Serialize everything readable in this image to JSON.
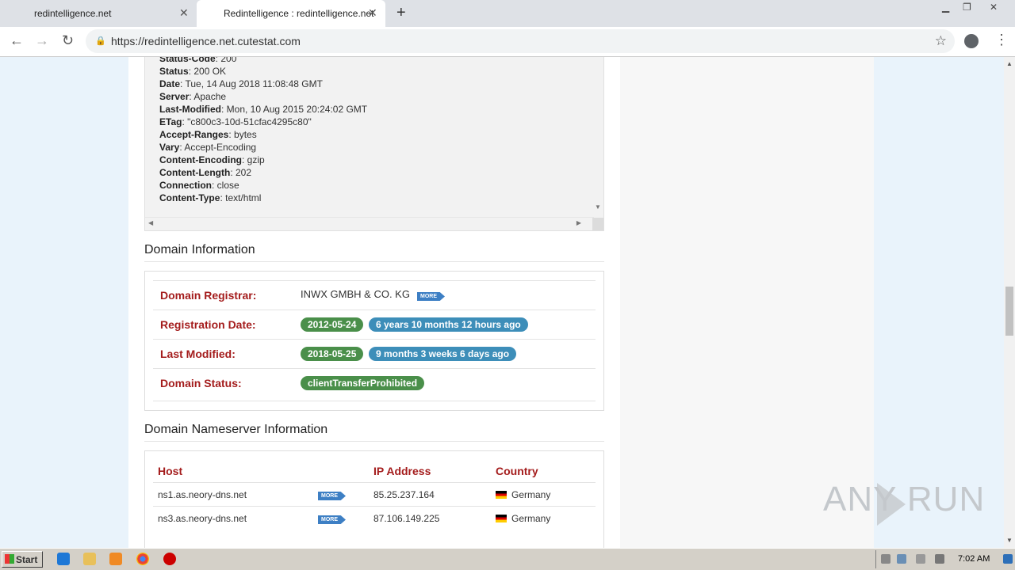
{
  "browser": {
    "tabs": [
      {
        "label": "redintelligence.net",
        "active": false
      },
      {
        "label": "Redintelligence : redintelligence.net",
        "active": true
      }
    ],
    "new_tab_icon": "plus-icon",
    "url": "https://redintelligence.net.cutestat.com"
  },
  "headers": [
    {
      "key": "Status-Code",
      "value": ": 200"
    },
    {
      "key": "Status",
      "value": ": 200 OK"
    },
    {
      "key": "Date",
      "value": ": Tue, 14 Aug 2018 11:08:48 GMT"
    },
    {
      "key": "Server",
      "value": ": Apache"
    },
    {
      "key": "Last-Modified",
      "value": ": Mon, 10 Aug 2015 20:24:02 GMT"
    },
    {
      "key": "ETag",
      "value": ": \"c800c3-10d-51cfac4295c80\""
    },
    {
      "key": "Accept-Ranges",
      "value": ": bytes"
    },
    {
      "key": "Vary",
      "value": ": Accept-Encoding"
    },
    {
      "key": "Content-Encoding",
      "value": ": gzip"
    },
    {
      "key": "Content-Length",
      "value": ": 202"
    },
    {
      "key": "Connection",
      "value": ": close"
    },
    {
      "key": "Content-Type",
      "value": ": text/html"
    }
  ],
  "domain_info": {
    "title": "Domain Information",
    "registrar_label": "Domain Registrar:",
    "registrar_value": "INWX GMBH & CO. KG",
    "more_label": "MORE",
    "registration_label": "Registration Date:",
    "registration_date": "2012-05-24",
    "registration_ago": "6 years 10 months 12 hours ago",
    "modified_label": "Last Modified:",
    "modified_date": "2018-05-25",
    "modified_ago": "9 months 3 weeks 6 days ago",
    "status_label": "Domain Status:",
    "status_value": "clientTransferProhibited"
  },
  "nameservers": {
    "title": "Domain Nameserver Information",
    "columns": [
      "Host",
      "IP Address",
      "Country"
    ],
    "rows": [
      {
        "host": "ns1.as.neory-dns.net",
        "more": "MORE",
        "ip": "85.25.237.164",
        "country": "Germany"
      },
      {
        "host": "ns3.as.neory-dns.net",
        "more": "MORE",
        "ip": "87.106.149.225",
        "country": "Germany"
      }
    ]
  },
  "watermark": "ANY RUN",
  "taskbar": {
    "start_label": "Start",
    "clock": "7:02 AM"
  },
  "colors": {
    "label_red": "#a41c1c",
    "badge_green": "#4a8f4a",
    "badge_blue": "#3d8eb9",
    "page_bg": "#e9f3fb"
  }
}
